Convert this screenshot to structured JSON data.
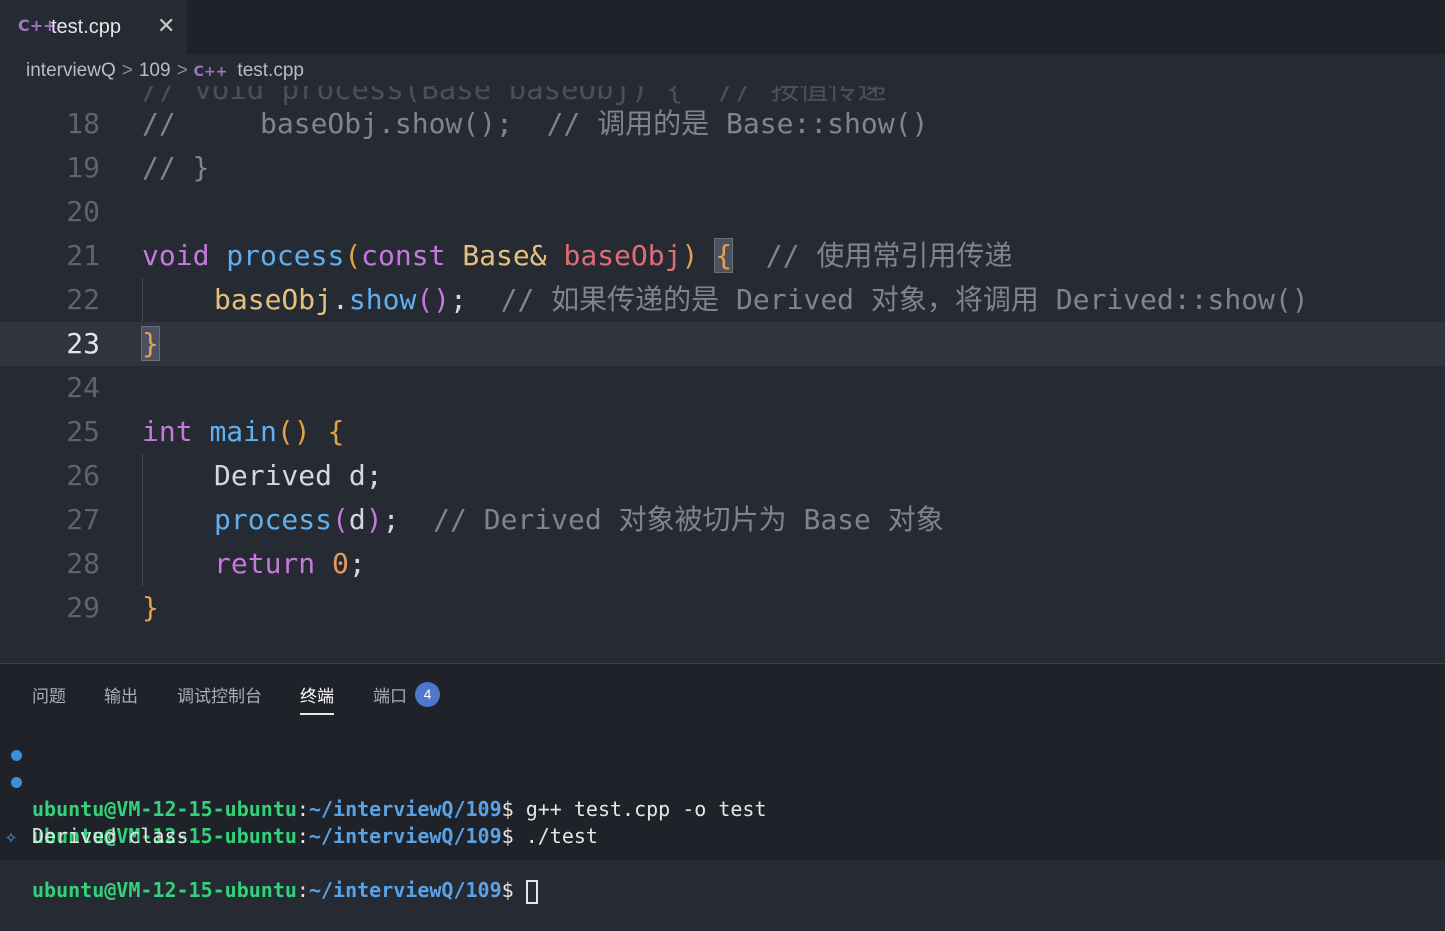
{
  "tab": {
    "filename": "test.cpp",
    "close": "✕",
    "icon": "C++"
  },
  "breadcrumb": {
    "folder": "interviewQ",
    "sub": "109",
    "file": "test.cpp",
    "sep": ">"
  },
  "editor": {
    "ghost_line": "// void process(Base baseObj) {  // 按值传递",
    "lines": {
      "l18": {
        "num": "18",
        "text": "//     baseObj.show();  // 调用的是 Base::show()"
      },
      "l19": {
        "num": "19",
        "text": "// }"
      },
      "l20": {
        "num": "20"
      },
      "l21": {
        "num": "21",
        "kw": "void",
        "fn": "process",
        "op": "(",
        "kw2": "const",
        "ty": "Base&",
        "va": "baseObj",
        "cp": ")",
        "ob": "{",
        "cm": "// 使用常引用传递"
      },
      "l22": {
        "num": "22",
        "obj": "baseObj",
        "dot": ".",
        "fn": "show",
        "paren": "()",
        "semi": ";",
        "cm": "// 如果传递的是 Derived 对象，将调用 Derived::show()"
      },
      "l23": {
        "num": "23",
        "cb": "}"
      },
      "l24": {
        "num": "24"
      },
      "l25": {
        "num": "25",
        "kw": "int",
        "fn": "main",
        "paren": "()",
        "ob": "{"
      },
      "l26": {
        "num": "26",
        "text": "Derived d;"
      },
      "l27": {
        "num": "27",
        "fn": "process",
        "op": "(",
        "arg": "d",
        "cp": ")",
        "semi": ";",
        "cm": "// Derived 对象被切片为 Base 对象"
      },
      "l28": {
        "num": "28",
        "kw": "return",
        "num_val": "0",
        "semi": ";"
      },
      "l29": {
        "num": "29",
        "cb": "}"
      }
    }
  },
  "panel": {
    "tabs": [
      "问题",
      "输出",
      "调试控制台",
      "终端",
      "端口"
    ],
    "active_tab": "终端",
    "ports_badge": "4"
  },
  "terminal": {
    "user": "ubuntu@VM-12-15-ubuntu",
    "colon": ":",
    "path": "~/interviewQ/109",
    "prompt": "$",
    "cmd1": " g++ test.cpp -o test",
    "cmd2": " ./test",
    "output": "Derived class"
  },
  "colors": {
    "keyword": "#c678dd",
    "function": "#61afef",
    "type": "#e5c07b",
    "variable": "#e06c75",
    "comment": "#7f848e",
    "terminal_user": "#33d17a",
    "terminal_path": "#5aa2e6"
  }
}
